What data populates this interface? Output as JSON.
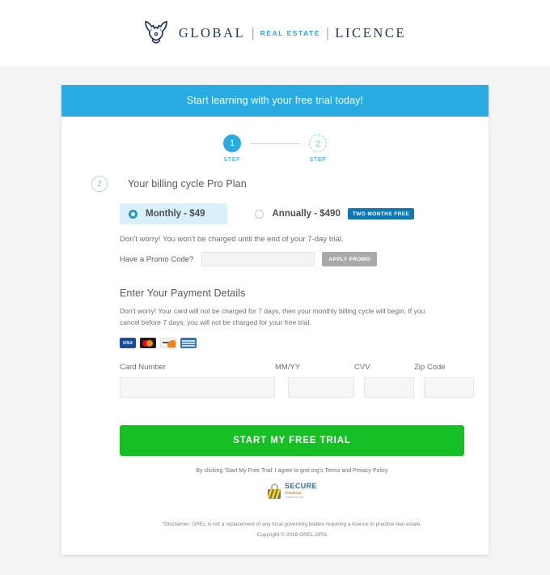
{
  "colors": {
    "banner_blue": "#29abe2",
    "cta_green": "#16c024",
    "badge_blue": "#1077b5",
    "page_bg": "#f4f4f4",
    "logo_navy": "#1b365d"
  },
  "logo": {
    "icon": "lion-head-icon",
    "word_1": "GLOBAL",
    "separator_1": "|",
    "word_2": "REAL ESTATE",
    "separator_2": "|",
    "word_3": "LICENCE"
  },
  "card": {
    "banner_text": "Start learning with your free trial today!"
  },
  "stepper": {
    "steps": [
      {
        "number": "1",
        "label": "STEP",
        "state": "active"
      },
      {
        "number": "2",
        "label": "STEP",
        "state": "inactive"
      }
    ]
  },
  "billing": {
    "badge_number": "2",
    "title": "Your billing cycle Pro Plan",
    "plans": [
      {
        "label": "Monthly - $49",
        "selected": true,
        "badge": null
      },
      {
        "label": "Annually - $490",
        "selected": false,
        "badge": "TWO MONTHS FREE"
      }
    ],
    "note": "Don't worry! You won't be charged until the end of your 7-day trial.",
    "promo_label": "Have a Promo Code?",
    "promo_value": "",
    "promo_placeholder": "",
    "promo_button": "APPLY PROMO"
  },
  "payment": {
    "title": "Enter Your Payment Details",
    "description": "Don't worry! Your card will not be charged for 7 days, then your monthly billing cycle will begin. If you cancel before 7 days, you will not be charged for your free trial.",
    "accepted_cards": [
      {
        "name": "visa-card-icon",
        "label": "VISA"
      },
      {
        "name": "mastercard-card-icon",
        "label": "Mastercard"
      },
      {
        "name": "discover-card-icon",
        "label": "Discover"
      },
      {
        "name": "amex-card-icon",
        "label": "American Express"
      }
    ],
    "fields": [
      {
        "label": "Card Number",
        "value": "",
        "placeholder": ""
      },
      {
        "label": "MM/YY",
        "value": "",
        "placeholder": ""
      },
      {
        "label": "CVV",
        "value": "",
        "placeholder": ""
      },
      {
        "label": "Zip Code",
        "value": "",
        "placeholder": ""
      }
    ]
  },
  "cta": {
    "label": "START MY FREE TRIAL",
    "terms": "By clicking 'Start My Free Trial' I agree to grel.org's Terms and Privacy Policy"
  },
  "secure_badge": {
    "icon": "padlock-icon",
    "main": "SECURE",
    "sub": "Checkout",
    "sub2": "Trusted site seal"
  },
  "footer": {
    "disclaimer": "*Disclaimer: GREL is not a replacement of any local governing bodies requiring a licence to practice real estate.",
    "copyright": "Copyright © 2018 GREL.ORG"
  }
}
